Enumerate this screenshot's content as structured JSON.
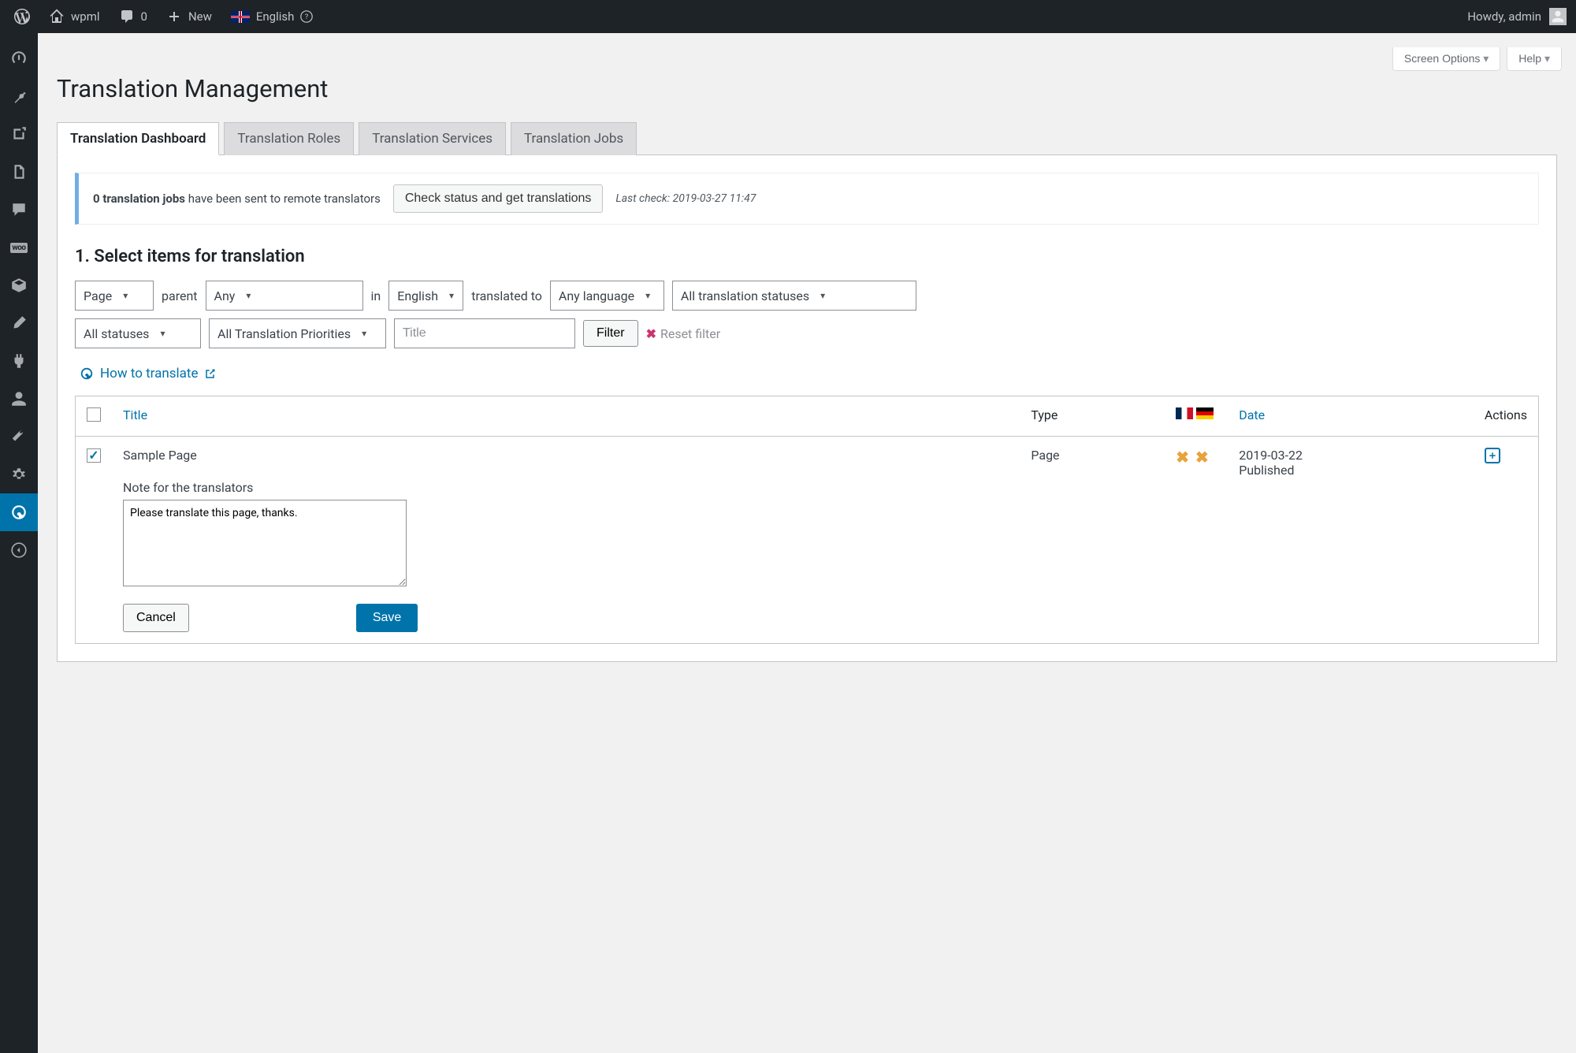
{
  "adminbar": {
    "site_name": "wpml",
    "comments_count": "0",
    "new_label": "New",
    "language": "English",
    "howdy": "Howdy, admin"
  },
  "screen_meta": {
    "screen_options": "Screen Options",
    "help": "Help"
  },
  "page_title": "Translation Management",
  "tabs": [
    {
      "label": "Translation Dashboard",
      "active": true
    },
    {
      "label": "Translation Roles",
      "active": false
    },
    {
      "label": "Translation Services",
      "active": false
    },
    {
      "label": "Translation Jobs",
      "active": false
    }
  ],
  "notice": {
    "jobs_count": "0 translation jobs",
    "jobs_suffix": " have been sent to remote translators",
    "check_button": "Check status and get translations",
    "last_check": "Last check: 2019-03-27 11:47"
  },
  "section_title": "1. Select items for translation",
  "filters": {
    "type": "Page",
    "parent_label": "parent",
    "parent_value": "Any",
    "in_label": "in",
    "lang": "English",
    "translated_to_label": "translated to",
    "target_lang": "Any language",
    "translation_status": "All translation statuses",
    "status": "All statuses",
    "priority": "All Translation Priorities",
    "title_placeholder": "Title",
    "filter_button": "Filter",
    "reset_label": "Reset filter"
  },
  "howto_link": "How to translate",
  "table": {
    "headers": {
      "title": "Title",
      "type": "Type",
      "date": "Date",
      "actions": "Actions"
    },
    "rows": [
      {
        "checked": true,
        "title": "Sample Page",
        "type": "Page",
        "date": "2019-03-22",
        "status": "Published"
      }
    ]
  },
  "note": {
    "label": "Note for the translators",
    "value": "Please translate this page, thanks.",
    "cancel": "Cancel",
    "save": "Save"
  }
}
